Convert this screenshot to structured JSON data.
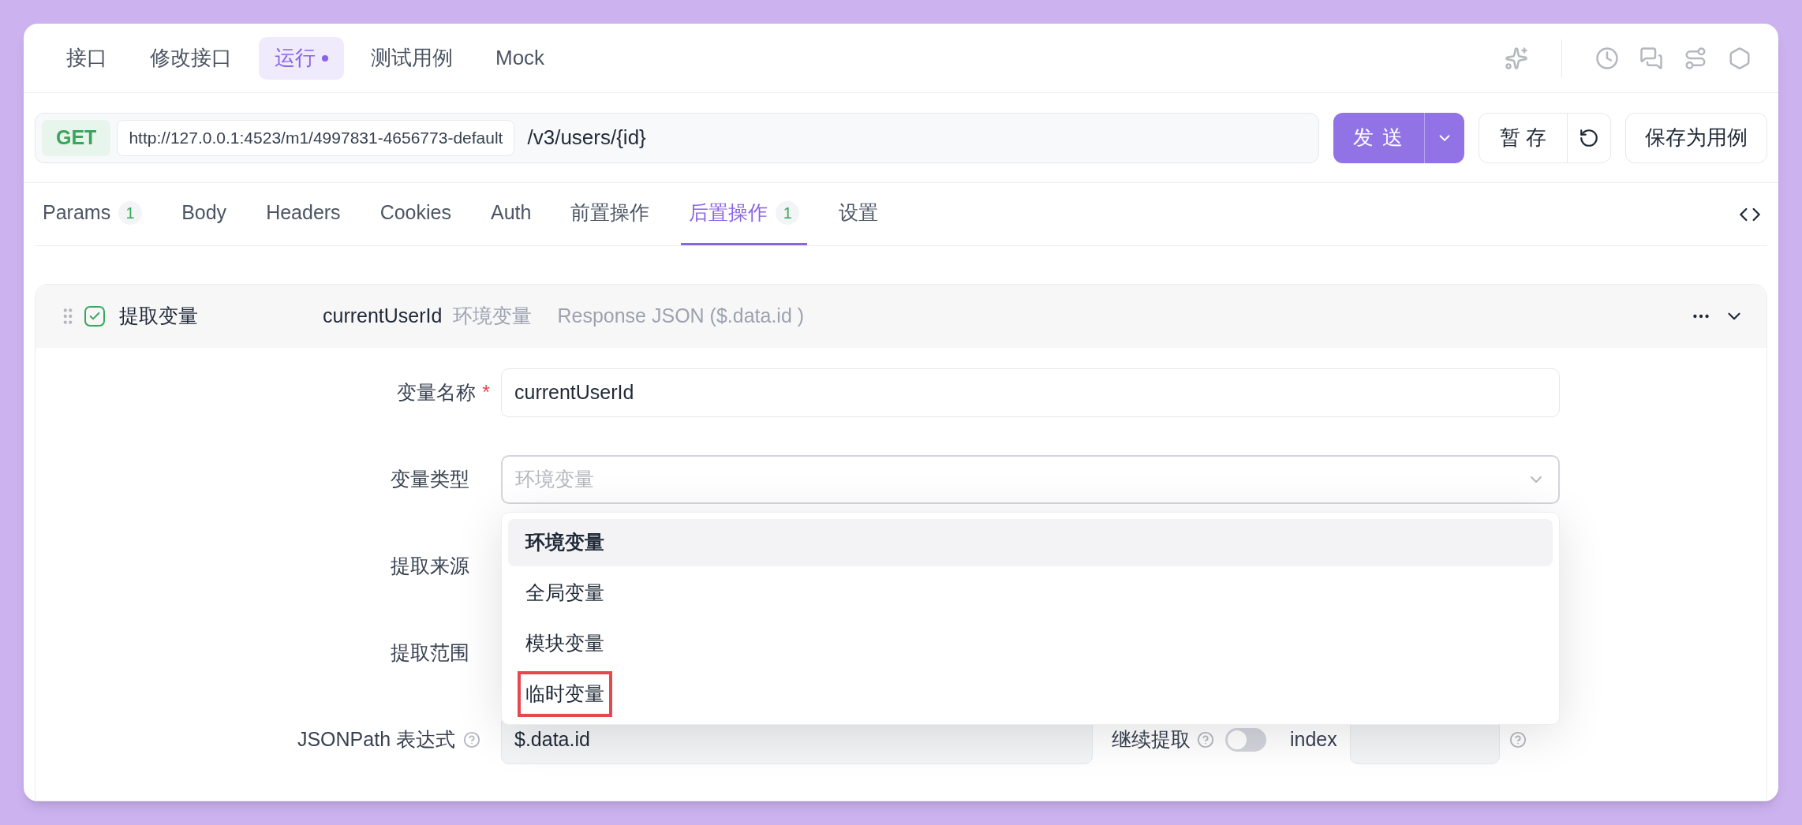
{
  "top_tabs": [
    {
      "label": "接口",
      "selected": false,
      "modified": false
    },
    {
      "label": "修改接口",
      "selected": false,
      "modified": false
    },
    {
      "label": "运行",
      "selected": true,
      "modified": true
    },
    {
      "label": "测试用例",
      "selected": false,
      "modified": false
    },
    {
      "label": "Mock",
      "selected": false,
      "modified": false
    }
  ],
  "request": {
    "method": "GET",
    "base_url": "http://127.0.0.1:4523/m1/4997831-4656773-default",
    "path": "/v3/users/{id}"
  },
  "buttons": {
    "send": "发 送",
    "stash": "暂 存",
    "save_case": "保存为用例"
  },
  "request_tabs": [
    {
      "label": "Params",
      "count": "1",
      "selected": false
    },
    {
      "label": "Body",
      "selected": false
    },
    {
      "label": "Headers",
      "selected": false
    },
    {
      "label": "Cookies",
      "selected": false
    },
    {
      "label": "Auth",
      "selected": false
    },
    {
      "label": "前置操作",
      "selected": false
    },
    {
      "label": "后置操作",
      "count": "1",
      "selected": true
    },
    {
      "label": "设置",
      "selected": false
    }
  ],
  "processor": {
    "enabled": true,
    "title": "提取变量",
    "variable": "currentUserId",
    "variable_type": "环境变量",
    "source": "Response JSON ($.data.id )"
  },
  "form": {
    "name_label": "变量名称",
    "required": true,
    "required_mark": "*",
    "name_value": "currentUserId",
    "type_label": "变量类型",
    "type_value": "环境变量",
    "source_label": "提取来源",
    "scope_label": "提取范围",
    "jsonpath_label": "JSONPath 表达式",
    "jsonpath_value": "$.data.id",
    "continue_label": "继续提取",
    "continue_on": false,
    "index_label": "index"
  },
  "dropdown": {
    "options": [
      {
        "label": "环境变量",
        "selected": true,
        "highlighted": false
      },
      {
        "label": "全局变量",
        "selected": false,
        "highlighted": false
      },
      {
        "label": "模块变量",
        "selected": false,
        "highlighted": false
      },
      {
        "label": "临时变量",
        "selected": false,
        "highlighted": true
      }
    ]
  }
}
